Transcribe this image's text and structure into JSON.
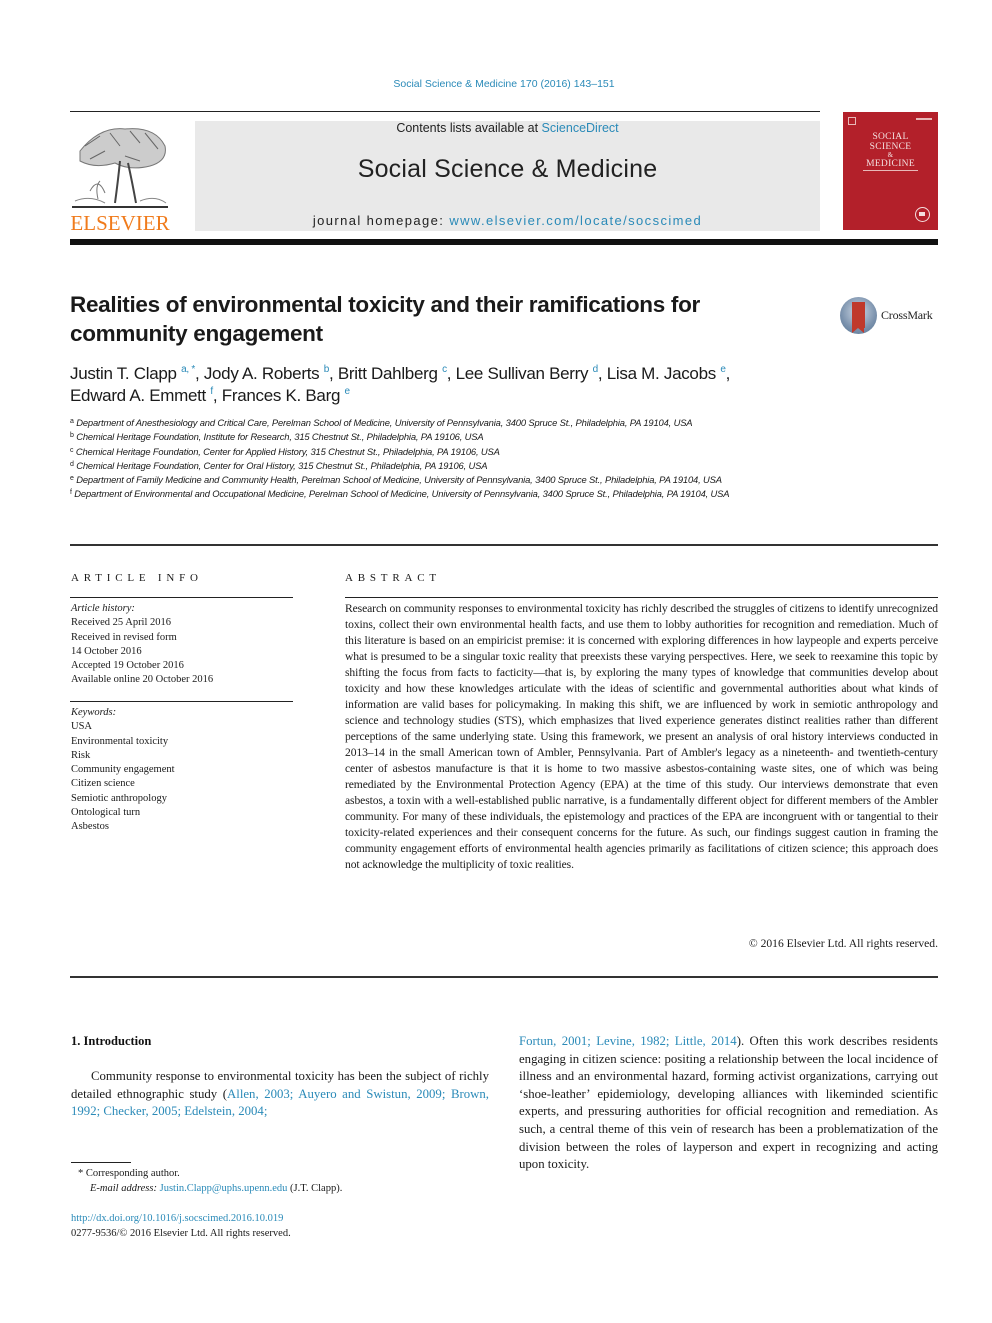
{
  "journal_ref": "Social Science & Medicine 170 (2016) 143–151",
  "masthead": {
    "publisher_logo_text": "ELSEVIER",
    "contents_prefix": "Contents lists available at ",
    "contents_link": "ScienceDirect",
    "journal_name": "Social Science & Medicine",
    "homepage_prefix": "journal homepage: ",
    "homepage_link": "www.elsevier.com/locate/socscimed",
    "cover": {
      "line1": "SOCIAL",
      "line2": "SCIENCE",
      "amp": "&",
      "line3": "MEDICINE",
      "color": "#b3202a"
    }
  },
  "article": {
    "title": "Realities of environmental toxicity and their ramifications for community engagement",
    "crossmark_label": "CrossMark",
    "authors": [
      {
        "name": "Justin T. Clapp",
        "sup": "a, *",
        "sep": ", "
      },
      {
        "name": "Jody A. Roberts",
        "sup": "b",
        "sep": ", "
      },
      {
        "name": "Britt Dahlberg",
        "sup": "c",
        "sep": ", "
      },
      {
        "name": "Lee Sullivan Berry",
        "sup": "d",
        "sep": ", "
      },
      {
        "name": "Lisa M. Jacobs",
        "sup": "e",
        "sep": ","
      },
      {
        "name": "Edward A. Emmett",
        "sup": "f",
        "sep": ", "
      },
      {
        "name": "Frances K. Barg",
        "sup": "e",
        "sep": ""
      }
    ],
    "affiliations": [
      {
        "key": "a",
        "text": "Department of Anesthesiology and Critical Care, Perelman School of Medicine, University of Pennsylvania, 3400 Spruce St., Philadelphia, PA 19104, USA"
      },
      {
        "key": "b",
        "text": "Chemical Heritage Foundation, Institute for Research, 315 Chestnut St., Philadelphia, PA 19106, USA"
      },
      {
        "key": "c",
        "text": "Chemical Heritage Foundation, Center for Applied History, 315 Chestnut St., Philadelphia, PA 19106, USA"
      },
      {
        "key": "d",
        "text": "Chemical Heritage Foundation, Center for Oral History, 315 Chestnut St., Philadelphia, PA 19106, USA"
      },
      {
        "key": "e",
        "text": "Department of Family Medicine and Community Health, Perelman School of Medicine, University of Pennsylvania, 3400 Spruce St., Philadelphia, PA 19104, USA"
      },
      {
        "key": "f",
        "text": "Department of Environmental and Occupational Medicine, Perelman School of Medicine, University of Pennsylvania, 3400 Spruce St., Philadelphia, PA 19104, USA"
      }
    ]
  },
  "article_info": {
    "heading": "ARTICLE INFO",
    "history_label": "Article history:",
    "history": [
      "Received 25 April 2016",
      "Received in revised form",
      "14 October 2016",
      "Accepted 19 October 2016",
      "Available online 20 October 2016"
    ],
    "keywords_label": "Keywords:",
    "keywords": [
      "USA",
      "Environmental toxicity",
      "Risk",
      "Community engagement",
      "Citizen science",
      "Semiotic anthropology",
      "Ontological turn",
      "Asbestos"
    ]
  },
  "abstract": {
    "heading": "ABSTRACT",
    "text": "Research on community responses to environmental toxicity has richly described the struggles of citizens to identify unrecognized toxins, collect their own environmental health facts, and use them to lobby authorities for recognition and remediation. Much of this literature is based on an empiricist premise: it is concerned with exploring differences in how laypeople and experts perceive what is presumed to be a singular toxic reality that preexists these varying perspectives. Here, we seek to reexamine this topic by shifting the focus from facts to facticity—that is, by exploring the many types of knowledge that communities develop about toxicity and how these knowledges articulate with the ideas of scientific and governmental authorities about what kinds of information are valid bases for policymaking. In making this shift, we are influenced by work in semiotic anthropology and science and technology studies (STS), which emphasizes that lived experience generates distinct realities rather than different perceptions of the same underlying state. Using this framework, we present an analysis of oral history interviews conducted in 2013–14 in the small American town of Ambler, Pennsylvania. Part of Ambler's legacy as a nineteenth- and twentieth-century center of asbestos manufacture is that it is home to two massive asbestos-containing waste sites, one of which was being remediated by the Environmental Protection Agency (EPA) at the time of this study. Our interviews demonstrate that even asbestos, a toxin with a well-established public narrative, is a fundamentally different object for different members of the Ambler community. For many of these individuals, the epistemology and practices of the EPA are incongruent with or tangential to their toxicity-related experiences and their consequent concerns for the future. As such, our findings suggest caution in framing the community engagement efforts of environmental health agencies primarily as facilitations of citizen science; this approach does not acknowledge the multiplicity of toxic realities.",
    "copyright": "© 2016 Elsevier Ltd. All rights reserved."
  },
  "introduction": {
    "heading": "1.  Introduction",
    "left_text_before": "Community response to environmental toxicity has been the subject of richly detailed ethnographic study (",
    "left_citations": "Allen, 2003; Auyero and Swistun, 2009; Brown, 1992; Checker, 2005; Edelstein, 2004;",
    "right_citations": "Fortun, 2001; Levine, 1982; Little, 2014",
    "right_text_after": "). Often this work describes residents engaging in citizen science: positing a relationship between the local incidence of illness and an environmental hazard, forming activist organizations, carrying out ‘shoe-leather’ epidemiology, developing alliances with likeminded scientific experts, and pressuring authorities for official recognition and remediation. As such, a central theme of this vein of research has been a problematization of the division between the roles of layperson and expert in recognizing and acting upon toxicity."
  },
  "footnotes": {
    "corresponding_marker": "*",
    "corresponding_text": "Corresponding author.",
    "email_label": "E-mail address:",
    "email": "Justin.Clapp@uphs.upenn.edu",
    "email_suffix": " (J.T. Clapp).",
    "doi": "http://dx.doi.org/10.1016/j.socscimed.2016.10.019",
    "issn_line": "0277-9536/© 2016 Elsevier Ltd. All rights reserved."
  },
  "colors": {
    "link": "#2a8ab8",
    "elsevier_orange": "#f07b1c",
    "masthead_bg": "#e9e9e9",
    "cover_red": "#b3202a"
  }
}
